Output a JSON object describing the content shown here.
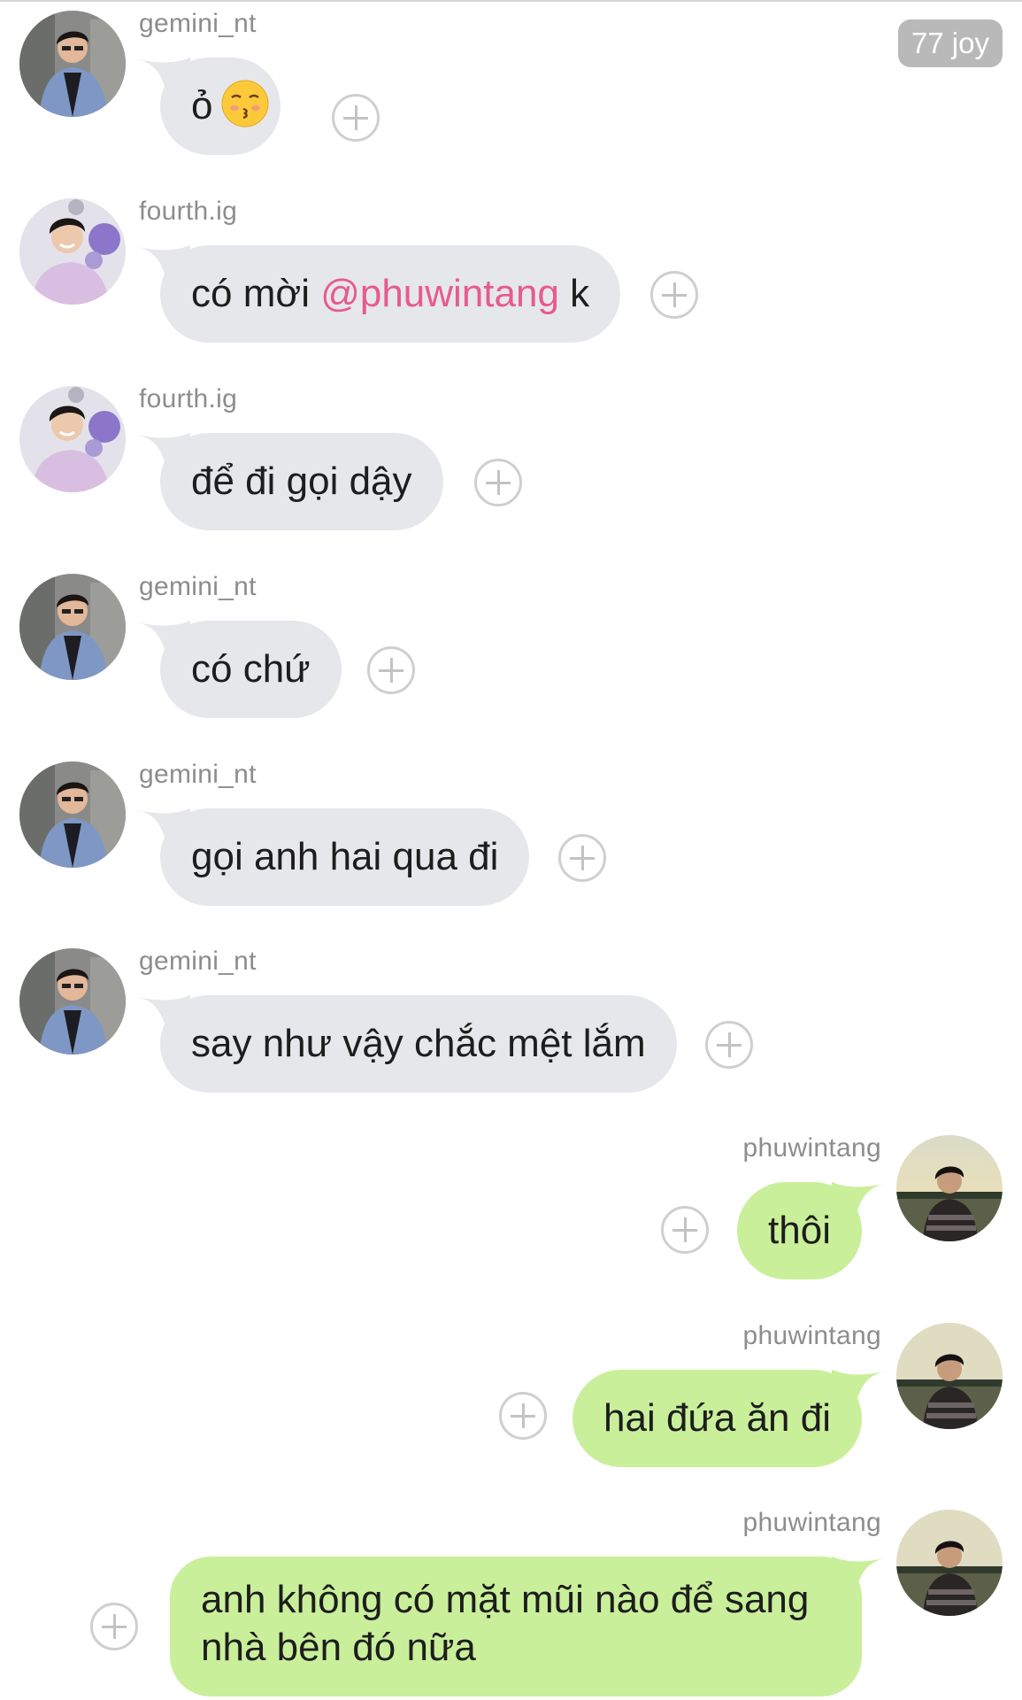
{
  "badge": {
    "text": "77 joy"
  },
  "messages": [
    {
      "side": "left",
      "user": "gemini_nt",
      "text": "ỏ",
      "emoji": "kissing-face-emoji",
      "avatar": "gemini-avatar"
    },
    {
      "side": "left",
      "user": "fourth.ig",
      "text_before": "có mời ",
      "mention": "@phuwintang",
      "text_after": " k",
      "avatar": "fourth-avatar"
    },
    {
      "side": "left",
      "user": "fourth.ig",
      "text": "để đi gọi dậy",
      "avatar": "fourth-avatar"
    },
    {
      "side": "left",
      "user": "gemini_nt",
      "text": "có chứ",
      "avatar": "gemini-avatar"
    },
    {
      "side": "left",
      "user": "gemini_nt",
      "text": "gọi anh hai qua đi",
      "avatar": "gemini-avatar"
    },
    {
      "side": "left",
      "user": "gemini_nt",
      "text": "say như vậy chắc mệt lắm",
      "avatar": "gemini-avatar"
    },
    {
      "side": "right",
      "user": "phuwintang",
      "text": "thôi",
      "avatar": "phuwin-avatar"
    },
    {
      "side": "right",
      "user": "phuwintang",
      "text": "hai đứa ăn đi",
      "avatar": "phuwin-avatar"
    },
    {
      "side": "right",
      "user": "phuwintang",
      "text": "anh không có mặt mũi nào để sang nhà bên đó nữa",
      "avatar": "phuwin-avatar"
    }
  ],
  "colors": {
    "incoming_bubble": "#e6e7eb",
    "outgoing_bubble": "#c9ef9a",
    "mention": "#e75b8c",
    "username": "#8d8d8d",
    "badge": "#b9b9b9"
  }
}
